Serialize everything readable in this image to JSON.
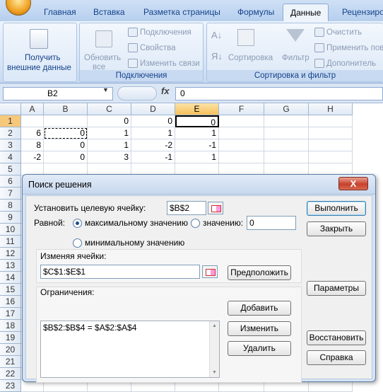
{
  "tabs": [
    "Главная",
    "Вставка",
    "Разметка страницы",
    "Формулы",
    "Данные",
    "Рецензиро"
  ],
  "ribbon": {
    "get_external_line1": "Получить",
    "get_external_line2": "внешние данные",
    "refresh_line1": "Обновить",
    "refresh_line2": "все",
    "connections": "Подключения",
    "properties": "Свойства",
    "edit_links": "Изменить связи",
    "group_connections": "Подключения",
    "sort": "Сортировка",
    "filter": "Фильтр",
    "clear": "Очистить",
    "reapply": "Применить пов",
    "advanced": "Дополнитель",
    "group_sort_filter": "Сортировка и фильтр"
  },
  "formula_bar": {
    "name_box": "B2",
    "fx": "fx",
    "value": "0"
  },
  "columns": [
    "A",
    "B",
    "C",
    "D",
    "E",
    "F",
    "G",
    "H"
  ],
  "rows": [
    "1",
    "2",
    "3",
    "4",
    "5",
    "6",
    "7",
    "8",
    "9",
    "10",
    "11",
    "12",
    "13",
    "14",
    "15",
    "16",
    "17",
    "18",
    "19",
    "20",
    "21",
    "22",
    "23"
  ],
  "cells": {
    "C1": "0",
    "D1": "0",
    "E1": "0",
    "A2": "6",
    "B2": "0",
    "C2": "1",
    "D2": "1",
    "E2": "1",
    "A3": "8",
    "B3": "0",
    "C3": "1",
    "D3": "-2",
    "E3": "-1",
    "A4": "-2",
    "B4": "0",
    "C4": "3",
    "D4": "-1",
    "E4": "1"
  },
  "solver": {
    "title": "Поиск решения",
    "close": "X",
    "target_label": "Установить целевую ячейку:",
    "target_value": "$B$2",
    "equal_label": "Равной:",
    "max_label": "максимальному значению",
    "value_label": "значению:",
    "value_input": "0",
    "min_label": "минимальному значению",
    "changing_label": "Изменяя ячейки:",
    "changing_value": "$C$1:$E$1",
    "constraints_label": "Ограничения:",
    "constraints": [
      "$B$2:$B$4 = $A$2:$A$4"
    ],
    "buttons": {
      "solve": "Выполнить",
      "close": "Закрыть",
      "guess": "Предположить",
      "options": "Параметры",
      "add": "Добавить",
      "change": "Изменить",
      "delete": "Удалить",
      "reset": "Восстановить",
      "help": "Справка"
    }
  }
}
